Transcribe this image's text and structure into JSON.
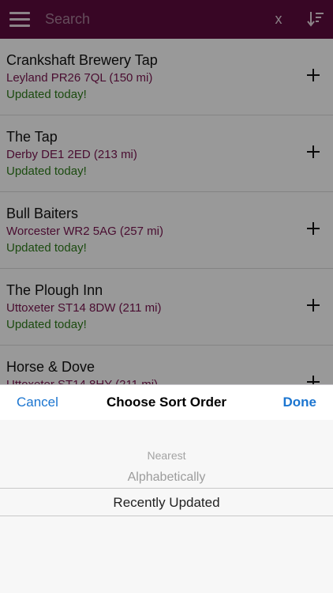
{
  "header": {
    "search_placeholder": "Search",
    "clear_label": "x",
    "menu_icon": "hamburger-menu-icon",
    "sort_icon": "sort-descending-icon",
    "bar_color": "#5e0b3e"
  },
  "venues": [
    {
      "name": "Crankshaft Brewery Tap",
      "address": "Leyland PR26 7QL (150 mi)",
      "status": "Updated today!"
    },
    {
      "name": "The Tap",
      "address": "Derby DE1 2ED (213 mi)",
      "status": "Updated today!"
    },
    {
      "name": "Bull Baiters",
      "address": "Worcester WR2 5AG (257 mi)",
      "status": "Updated today!"
    },
    {
      "name": "The Plough Inn",
      "address": "Uttoxeter ST14 8DW (211 mi)",
      "status": "Updated today!"
    },
    {
      "name": "Horse & Dove",
      "address": "Uttoxeter ST14 8HY (211 mi)",
      "status": ""
    }
  ],
  "sort_sheet": {
    "cancel_label": "Cancel",
    "title": "Choose Sort Order",
    "done_label": "Done",
    "options": [
      "Nearest",
      "Alphabetically",
      "Recently Updated"
    ],
    "selected_index": 2
  },
  "colors": {
    "accent_blue": "#1b75d0",
    "address_color": "#7a1550",
    "status_color": "#2e7d1a"
  }
}
